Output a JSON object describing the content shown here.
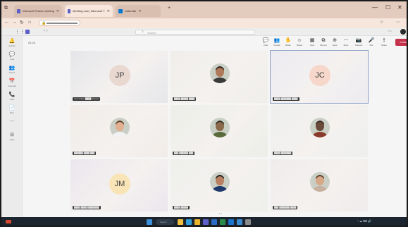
{
  "browser": {
    "tabs": [
      {
        "label": "Microsoft Teams meeting",
        "active": false,
        "color": "#5b5fc7"
      },
      {
        "label": "Meeting now | Microsoft T",
        "active": true,
        "color": "#5b5fc7"
      },
      {
        "label": "Calendar",
        "active": false,
        "color": "#0078d4"
      }
    ],
    "new_tab": "+",
    "window_controls": [
      "—",
      "☐",
      "✕"
    ],
    "nav_icons": [
      "←",
      "→",
      "↻",
      "⌂"
    ],
    "lock_icon": "🔒",
    "right_icons": [
      "☆",
      "⋯"
    ]
  },
  "teams": {
    "search_placeholder": "Search",
    "header_right": [
      "⋯",
      "👤"
    ]
  },
  "rail": [
    {
      "icon": "activity-icon",
      "glyph": "🔔",
      "label": "Activity",
      "active": false
    },
    {
      "icon": "chat-icon",
      "glyph": "💬",
      "label": "Chat",
      "active": true
    },
    {
      "icon": "teams-icon",
      "glyph": "👥",
      "label": "Teams",
      "active": false
    },
    {
      "icon": "calendar-icon",
      "glyph": "📅",
      "label": "Calendar",
      "active": false
    },
    {
      "icon": "calls-icon",
      "glyph": "📞",
      "label": "Calls",
      "active": false
    },
    {
      "icon": "files-icon",
      "glyph": "📄",
      "label": "Files",
      "active": false
    },
    {
      "icon": "apps-icon",
      "glyph": "⋯",
      "label": "",
      "active": false
    },
    {
      "icon": "more-apps-icon",
      "glyph": "⊞",
      "label": "Apps",
      "active": false
    }
  ],
  "meeting": {
    "timer": "01:23",
    "controls": [
      {
        "name": "chat",
        "glyph": "💬",
        "label": "Chat"
      },
      {
        "name": "people",
        "glyph": "👥",
        "label": "People"
      },
      {
        "name": "raise",
        "glyph": "✋",
        "label": "Raise"
      },
      {
        "name": "react",
        "glyph": "☺",
        "label": "React"
      },
      {
        "name": "view",
        "glyph": "▦",
        "label": "View"
      },
      {
        "name": "rooms",
        "glyph": "⧉",
        "label": "Rooms"
      },
      {
        "name": "apps",
        "glyph": "⊕",
        "label": "Apps"
      },
      {
        "name": "more",
        "glyph": "⋯",
        "label": "More"
      },
      {
        "name": "camera",
        "glyph": "📷",
        "label": "Camera"
      },
      {
        "name": "mic",
        "glyph": "🎤",
        "label": "Mic"
      },
      {
        "name": "share",
        "glyph": "⇪",
        "label": "Share"
      }
    ],
    "leave_label": "Leave"
  },
  "tiles": [
    {
      "kind": "initials",
      "initials": "JP",
      "bg": "#e6e6ea",
      "avatar": "#e8d8d0",
      "name": "Juan Pablo ████ (Guest)",
      "selected": false
    },
    {
      "kind": "photo",
      "bg": "#f0eeea",
      "skin": "#b07a5a",
      "hair": "#2a1d16",
      "shirt": "#3a3a3a",
      "name": "████ █████ ████",
      "selected": false
    },
    {
      "kind": "initials",
      "initials": "JC",
      "bg": "#ecebf1",
      "avatar": "#f6d7c9",
      "name": "████ ███████ ████",
      "selected": true
    },
    {
      "kind": "photo",
      "bg": "#f1ece8",
      "skin": "#e0b090",
      "hair": "#5a3520",
      "shirt": "#f2f2f2",
      "name": "██████ ████ ███",
      "selected": false
    },
    {
      "kind": "photo",
      "bg": "#eceee8",
      "skin": "#8a6a4a",
      "hair": "#2e2a20",
      "shirt": "#5a6a3a",
      "name": "███ ██████ ███",
      "selected": false
    },
    {
      "kind": "photo",
      "bg": "#eef0ee",
      "skin": "#6a4a3a",
      "hair": "#3a2620",
      "shirt": "#8a3a2a",
      "name": "████ ███████",
      "selected": false
    },
    {
      "kind": "initials",
      "initials": "JM",
      "bg": "#ebe6ee",
      "avatar": "#f9e4b7",
      "name": "████ ████ ████████",
      "selected": false
    },
    {
      "kind": "photo",
      "bg": "#eef0ec",
      "skin": "#b88060",
      "hair": "#1a1a1a",
      "shirt": "#1d3a6a",
      "name": "████ █████",
      "selected": false
    },
    {
      "kind": "photo",
      "bg": "#efecec",
      "skin": "#d6a888",
      "hair": "#5a3a28",
      "shirt": "#c8b0a0",
      "name": "███ ███████ ████",
      "selected": false
    }
  ],
  "page_indicator": "• •",
  "taskbar": {
    "weather": "",
    "search_label": "Search",
    "apps": [
      {
        "icon": "windows-start-icon",
        "color": "#3b8fd9"
      },
      {
        "icon": "file-explorer-icon",
        "color": "#f0c040"
      },
      {
        "icon": "edge-icon",
        "color": "#2f9ed8"
      },
      {
        "icon": "chrome-icon",
        "color": "#e9b32a"
      },
      {
        "icon": "teams-taskbar-icon",
        "color": "#5b5fc7"
      },
      {
        "icon": "word-icon",
        "color": "#2b6ac6"
      },
      {
        "icon": "excel-icon",
        "color": "#2a8a4a"
      },
      {
        "icon": "outlook-icon",
        "color": "#1a73c8"
      },
      {
        "icon": "store-icon",
        "color": "#3a8ad0"
      },
      {
        "icon": "settings-taskbar-icon",
        "color": "#8a8a8a"
      }
    ],
    "tray_icons": "^  ☁  ⌨  🔊",
    "time": ""
  }
}
